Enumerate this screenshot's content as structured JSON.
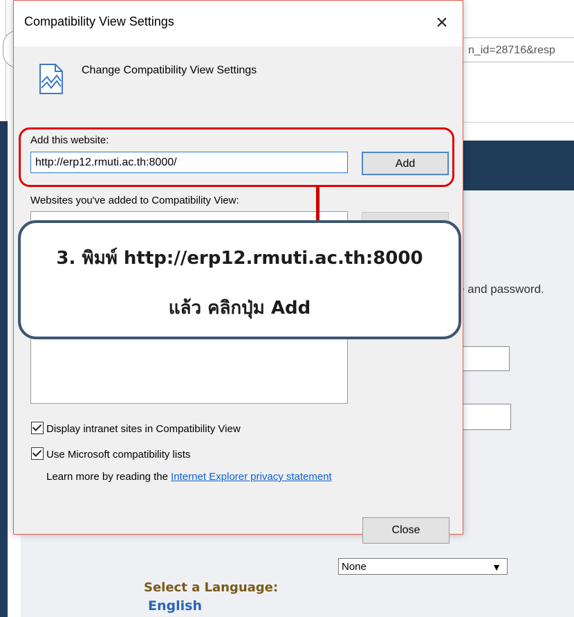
{
  "background": {
    "address_text": "n_id=28716&resp",
    "password_hint": "e and password.",
    "language_select_value": "None",
    "language_label": "Select a Language:",
    "language_value": "English"
  },
  "dialog": {
    "title": "Compatibility View Settings",
    "close_glyph": "×",
    "header_text": "Change Compatibility View Settings",
    "add_website_label": "Add this website:",
    "url_value": "http://erp12.rmuti.ac.th:8000/",
    "add_button": "Add",
    "added_sites_label": "Websites you've added to Compatibility View:",
    "checkboxes": [
      {
        "label": "Display intranet sites in Compatibility View",
        "checked": true
      },
      {
        "label": "Use Microsoft compatibility lists",
        "checked": true
      }
    ],
    "learn_more_prefix": "Learn more by reading the ",
    "learn_more_link": "Internet Explorer privacy statement",
    "close_button": "Close"
  },
  "annotation": {
    "line1": "3. พิมพ์ http://erp12.rmuti.ac.th:8000",
    "line2": "แล้ว คลิกปุ่ม Add",
    "highlight_color": "#e00000",
    "callout_border_color": "#3d5671"
  }
}
